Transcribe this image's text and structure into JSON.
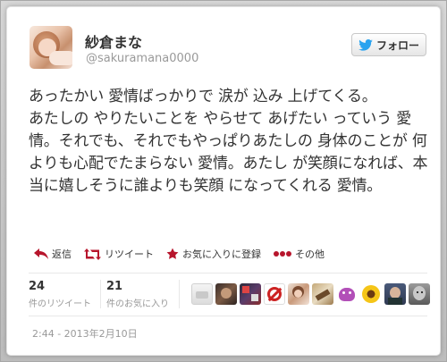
{
  "user": {
    "display_name": "紗倉まな",
    "handle": "@sakuramana0000"
  },
  "follow_button": {
    "label": "フォロー"
  },
  "tweet": {
    "text": "あったかい 愛情ばっかりで 涙が 込み 上げてくる。\nあたしの やりたいことを やらせて あげたい っていう 愛情。それでも、それでもやっぱりあたしの 身体のことが 何よりも心配でたまらない 愛情。あたし が笑顔になれば、本当に嬉しそうに誰よりも笑顔 になってくれる 愛情。"
  },
  "actions": {
    "reply": "返信",
    "retweet": "リツイート",
    "favorite": "お気に入りに登録",
    "more": "その他"
  },
  "stats": {
    "retweets": {
      "count": "24",
      "label": "件のリツイート"
    },
    "favorites": {
      "count": "21",
      "label": "件のお気に入り"
    }
  },
  "favorited_by": [
    "fav-avatar-1",
    "fav-avatar-2",
    "fav-avatar-3",
    "fav-avatar-4",
    "fav-avatar-5",
    "fav-avatar-6",
    "fav-avatar-7",
    "fav-avatar-8",
    "fav-avatar-9",
    "fav-avatar-10"
  ],
  "timestamp": "2:44 - 2013年2月10日",
  "colors": {
    "accent_red": "#b7152c",
    "twitter_blue": "#2aa3ef",
    "text": "#333333",
    "muted": "#999999"
  },
  "icons": {
    "reply": "reply-icon",
    "retweet": "retweet-icon",
    "favorite": "star-icon",
    "more": "more-dots-icon",
    "follow": "twitter-bird-icon"
  }
}
